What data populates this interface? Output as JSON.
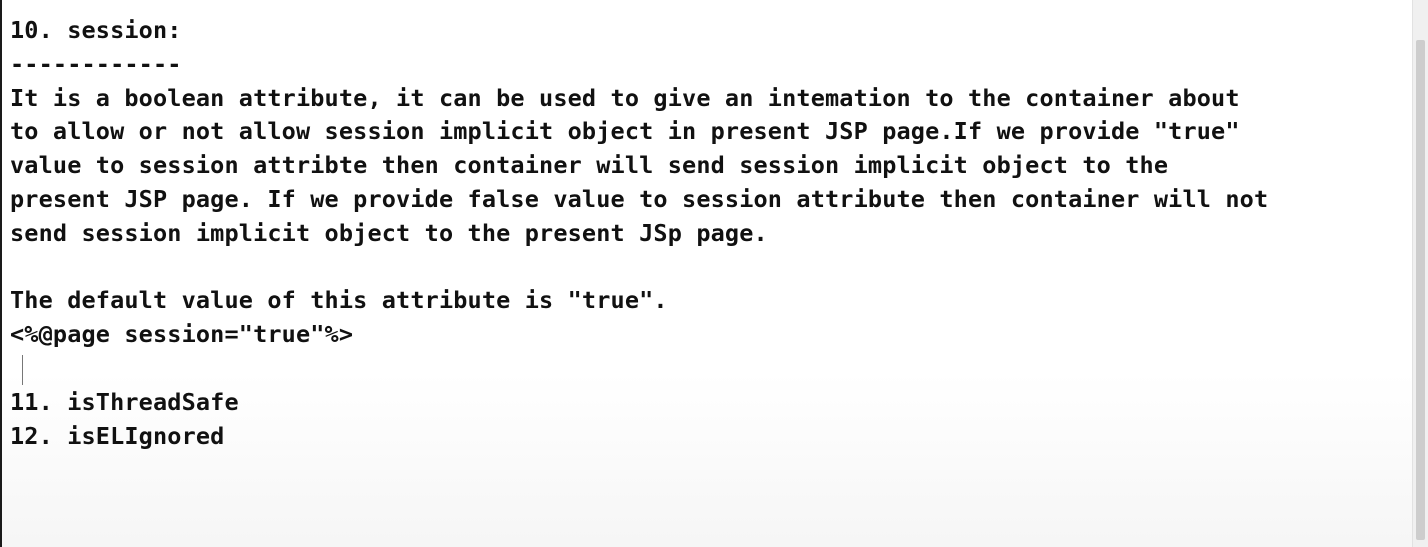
{
  "document": {
    "lines": [
      "10. session:",
      "------------",
      "It is a boolean attribute, it can be used to give an intemation to the container about",
      "to allow or not allow session implicit object in present JSP page.If we provide \"true\"",
      "value to session attribte then container will send session implicit object to the",
      "present JSP page. If we provide false value to session attribute then container will not",
      "send session implicit object to the present JSp page.",
      "",
      "The default value of this attribute is \"true\".",
      "<%@page session=\"true\"%>",
      "",
      "11. isThreadSafe",
      "12. isELIgnored"
    ]
  }
}
